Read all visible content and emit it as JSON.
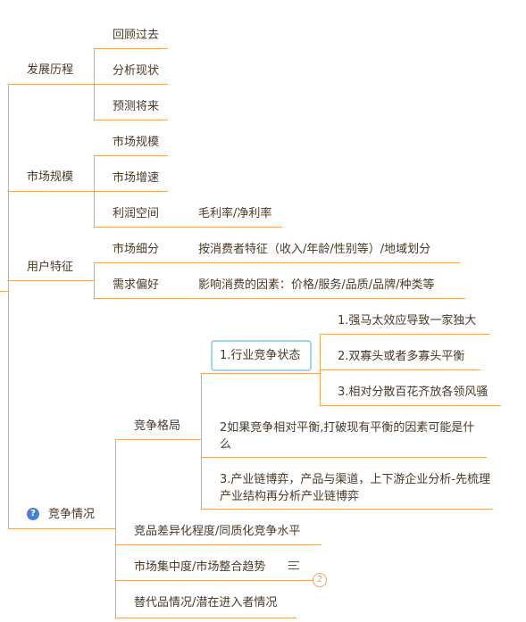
{
  "mindmap": {
    "line_color": "#f0a45e",
    "branches": [
      {
        "label": "发展历程",
        "children": [
          {
            "label": "回顾过去"
          },
          {
            "label": "分析现状"
          },
          {
            "label": "预测将来"
          }
        ]
      },
      {
        "label": "市场规模",
        "children": [
          {
            "label": "市场规模"
          },
          {
            "label": "市场增速"
          },
          {
            "label": "利润空间",
            "detail": "毛利率/净利率"
          }
        ]
      },
      {
        "label": "用户特征",
        "children": [
          {
            "label": "市场细分",
            "detail": "按消费者特征（收入/年龄/性别等）/地域划分"
          },
          {
            "label": "需求偏好",
            "detail": "影响消费的因素：价格/服务/品质/品牌/种类等"
          }
        ]
      },
      {
        "label": "竞争情况",
        "icon": "question-icon",
        "children": [
          {
            "label": "竞争格局",
            "children": [
              {
                "label": "1.行业竞争状态",
                "selected": true,
                "children": [
                  {
                    "label": "1.强马太效应导致一家独大"
                  },
                  {
                    "label": "2.双寡头或者多寡头平衡"
                  },
                  {
                    "label": "3.相对分散百花齐放各领风骚"
                  }
                ]
              },
              {
                "label": "2如果竞争相对平衡,打破现有平衡的因素可能是什么"
              },
              {
                "label": "3.产业链博弈，产品与渠道，上下游企业分析-先梳理产业结构再分析产业链博弈"
              }
            ]
          },
          {
            "label": "竞品差异化程度/同质化竞争水平"
          },
          {
            "label": "市场集中度/市场整合趋势",
            "has_note": true,
            "collapsed_count": "2"
          },
          {
            "label": "替代品情况/潜在进入者情况"
          }
        ]
      }
    ]
  }
}
